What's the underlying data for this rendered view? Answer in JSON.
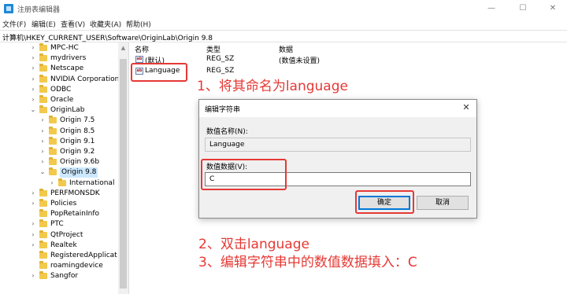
{
  "window": {
    "title": "注册表编辑器",
    "controls": [
      "—",
      "☐",
      "✕"
    ]
  },
  "menu": [
    "文件(F)",
    "编辑(E)",
    "查看(V)",
    "收藏夹(A)",
    "帮助(H)"
  ],
  "address": "计算机\\HKEY_CURRENT_USER\\Software\\OriginLab\\Origin 9.8",
  "tree": [
    {
      "label": "MPC-HC",
      "level": 0,
      "chevron": "›"
    },
    {
      "label": "mydrivers",
      "level": 0,
      "chevron": "›"
    },
    {
      "label": "Netscape",
      "level": 0,
      "chevron": "›"
    },
    {
      "label": "NVIDIA Corporation",
      "level": 0,
      "chevron": "›"
    },
    {
      "label": "ODBC",
      "level": 0,
      "chevron": "›"
    },
    {
      "label": "Oracle",
      "level": 0,
      "chevron": "›"
    },
    {
      "label": "OriginLab",
      "level": 0,
      "chevron": "⌄"
    },
    {
      "label": "Origin 7.5",
      "level": 1,
      "chevron": "›"
    },
    {
      "label": "Origin 8.5",
      "level": 1,
      "chevron": "›"
    },
    {
      "label": "Origin 9.1",
      "level": 1,
      "chevron": "›"
    },
    {
      "label": "Origin 9.2",
      "level": 1,
      "chevron": "›"
    },
    {
      "label": "Origin 9.6b",
      "level": 1,
      "chevron": "›"
    },
    {
      "label": "Origin 9.8",
      "level": 1,
      "chevron": "⌄",
      "selected": true
    },
    {
      "label": "International",
      "level": 2,
      "chevron": "›"
    },
    {
      "label": "PERFMONSDK",
      "level": 0,
      "chevron": "›"
    },
    {
      "label": "Policies",
      "level": 0,
      "chevron": "›"
    },
    {
      "label": "PopRetainInfo",
      "level": 0,
      "chevron": ""
    },
    {
      "label": "PTC",
      "level": 0,
      "chevron": "›"
    },
    {
      "label": "QtProject",
      "level": 0,
      "chevron": "›"
    },
    {
      "label": "Realtek",
      "level": 0,
      "chevron": "›"
    },
    {
      "label": "RegisteredApplicat",
      "level": 0,
      "chevron": ""
    },
    {
      "label": "roamingdevice",
      "level": 0,
      "chevron": ""
    },
    {
      "label": "Sangfor",
      "level": 0,
      "chevron": "›"
    }
  ],
  "list": {
    "columns": [
      "名称",
      "类型",
      "数据"
    ],
    "rows": [
      {
        "name": "(默认)",
        "type": "REG_SZ",
        "data": "(数值未设置)"
      },
      {
        "name": "Language",
        "type": "REG_SZ",
        "data": ""
      }
    ]
  },
  "dialog": {
    "title": "编辑字符串",
    "name_label": "数值名称(N):",
    "name_value": "Language",
    "data_label": "数值数据(V):",
    "data_value": "C",
    "ok_label": "确定",
    "cancel_label": "取消"
  },
  "annotations": [
    "1、将其命名为language",
    "2、双击language",
    "3、编辑字符串中的数值数据填入：C"
  ],
  "colors": {
    "highlight": "#e53935",
    "selection": "#cce8ff",
    "accent": "#0078d7"
  }
}
